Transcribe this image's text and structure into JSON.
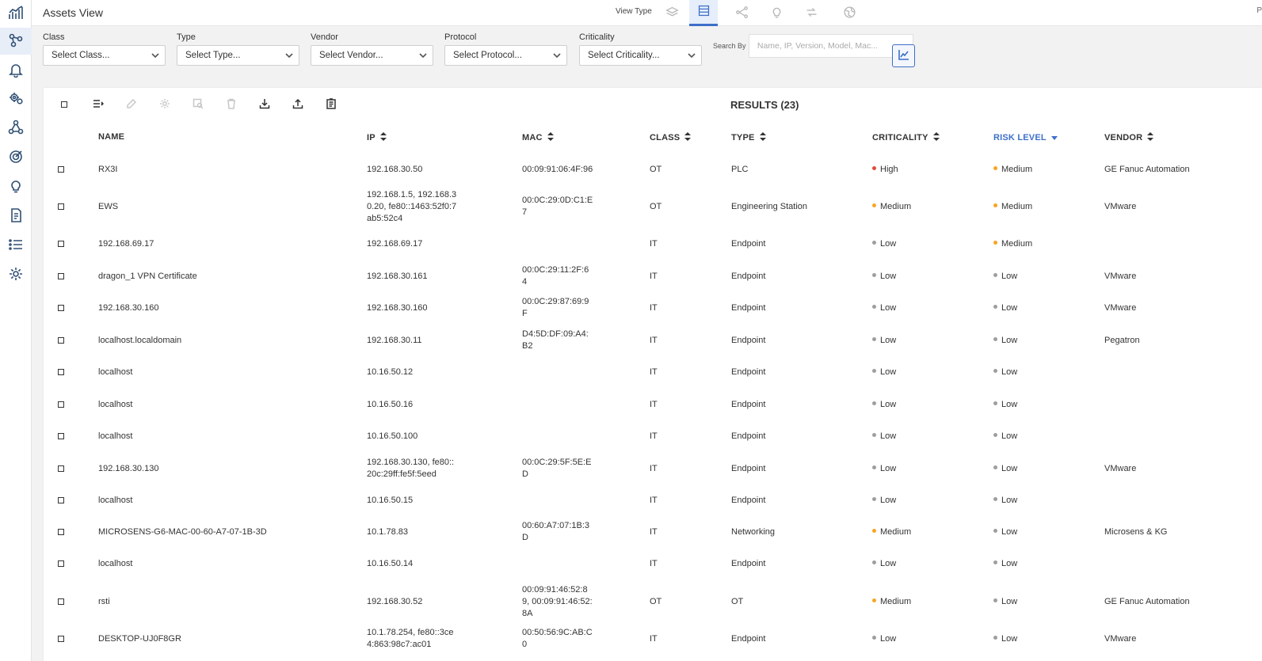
{
  "header": {
    "title": "Assets View",
    "view_type_label": "View Type",
    "right_partial": "P"
  },
  "view_types": [
    {
      "icon": "layers-icon",
      "active": false
    },
    {
      "icon": "list-icon",
      "active": true
    },
    {
      "icon": "topology-icon",
      "active": false
    },
    {
      "icon": "lightbulb-icon",
      "active": false
    },
    {
      "icon": "links-icon",
      "active": false
    },
    {
      "icon": "map-icon",
      "active": false
    }
  ],
  "nav": [
    {
      "icon": "chart-icon"
    },
    {
      "icon": "assets-icon",
      "active": true
    },
    {
      "icon": "bell-icon"
    },
    {
      "icon": "gears-icon"
    },
    {
      "icon": "network-icon"
    },
    {
      "icon": "target-icon"
    },
    {
      "icon": "lightbulb-icon"
    },
    {
      "icon": "document-icon"
    },
    {
      "icon": "list-icon"
    },
    {
      "icon": "settings-icon"
    }
  ],
  "filters": {
    "class": {
      "label": "Class",
      "value": "Select Class..."
    },
    "type": {
      "label": "Type",
      "value": "Select Type..."
    },
    "vendor": {
      "label": "Vendor",
      "value": "Select Vendor..."
    },
    "protocol": {
      "label": "Protocol",
      "value": "Select Protocol..."
    },
    "criticality": {
      "label": "Criticality",
      "value": "Select Criticality..."
    },
    "search": {
      "label": "Search By",
      "placeholder": "Name, IP, Version, Model, Mac..."
    }
  },
  "results_label": "RESULTS (23)",
  "columns": {
    "name": "NAME",
    "ip": "IP",
    "mac": "MAC",
    "class": "CLASS",
    "type": "TYPE",
    "criticality": "CRITICALITY",
    "risk": "RISK LEVEL",
    "vendor": "VENDOR"
  },
  "level_colors": {
    "High": "#e14b3b",
    "Medium": "#f5a623",
    "Low": "#9e9e9e"
  },
  "rows": [
    {
      "name": "RX3I",
      "ip": "192.168.30.50",
      "mac": "00:09:91:06:4F:96",
      "class": "OT",
      "type": "PLC",
      "criticality": "High",
      "risk": "Medium",
      "vendor": "GE Fanuc Automation"
    },
    {
      "name": "EWS",
      "ip": "192.168.1.5, 192.168.30.20, fe80::1463:52f0:7ab5:52c4",
      "mac": "00:0C:29:0D:C1:E7",
      "class": "OT",
      "type": "Engineering Station",
      "criticality": "Medium",
      "risk": "Medium",
      "vendor": "VMware"
    },
    {
      "name": "192.168.69.17",
      "ip": "192.168.69.17",
      "mac": "",
      "class": "IT",
      "type": "Endpoint",
      "criticality": "Low",
      "risk": "Medium",
      "vendor": ""
    },
    {
      "name": "dragon_1 VPN Certificate",
      "ip": "192.168.30.161",
      "mac": "00:0C:29:11:2F:64",
      "class": "IT",
      "type": "Endpoint",
      "criticality": "Low",
      "risk": "Low",
      "vendor": "VMware"
    },
    {
      "name": "192.168.30.160",
      "ip": "192.168.30.160",
      "mac": "00:0C:29:87:69:9F",
      "class": "IT",
      "type": "Endpoint",
      "criticality": "Low",
      "risk": "Low",
      "vendor": "VMware"
    },
    {
      "name": "localhost.localdomain",
      "ip": "192.168.30.11",
      "mac": "D4:5D:DF:09:A4:B2",
      "class": "IT",
      "type": "Endpoint",
      "criticality": "Low",
      "risk": "Low",
      "vendor": "Pegatron"
    },
    {
      "name": "localhost",
      "ip": "10.16.50.12",
      "mac": "",
      "class": "IT",
      "type": "Endpoint",
      "criticality": "Low",
      "risk": "Low",
      "vendor": ""
    },
    {
      "name": "localhost",
      "ip": "10.16.50.16",
      "mac": "",
      "class": "IT",
      "type": "Endpoint",
      "criticality": "Low",
      "risk": "Low",
      "vendor": ""
    },
    {
      "name": "localhost",
      "ip": "10.16.50.100",
      "mac": "",
      "class": "IT",
      "type": "Endpoint",
      "criticality": "Low",
      "risk": "Low",
      "vendor": ""
    },
    {
      "name": "192.168.30.130",
      "ip": "192.168.30.130, fe80::20c:29ff:fe5f:5eed",
      "mac": "00:0C:29:5F:5E:ED",
      "class": "IT",
      "type": "Endpoint",
      "criticality": "Low",
      "risk": "Low",
      "vendor": "VMware"
    },
    {
      "name": "localhost",
      "ip": "10.16.50.15",
      "mac": "",
      "class": "IT",
      "type": "Endpoint",
      "criticality": "Low",
      "risk": "Low",
      "vendor": ""
    },
    {
      "name": "MICROSENS-G6-MAC-00-60-A7-07-1B-3D",
      "ip": "10.1.78.83",
      "mac": "00:60:A7:07:1B:3D",
      "class": "IT",
      "type": "Networking",
      "criticality": "Medium",
      "risk": "Low",
      "vendor": "Microsens & KG"
    },
    {
      "name": "localhost",
      "ip": "10.16.50.14",
      "mac": "",
      "class": "IT",
      "type": "Endpoint",
      "criticality": "Low",
      "risk": "Low",
      "vendor": ""
    },
    {
      "name": "rsti",
      "ip": "192.168.30.52",
      "mac": "00:09:91:46:52:89, 00:09:91:46:52:8A",
      "class": "OT",
      "type": "OT",
      "criticality": "Medium",
      "risk": "Low",
      "vendor": "GE Fanuc Automation"
    },
    {
      "name": "DESKTOP-UJ0F8GR",
      "ip": "10.1.78.254, fe80::3ce4:863:98c7:ac01",
      "mac": "00:50:56:9C:AB:C0",
      "class": "IT",
      "type": "Endpoint",
      "criticality": "Low",
      "risk": "Low",
      "vendor": "VMware"
    }
  ]
}
